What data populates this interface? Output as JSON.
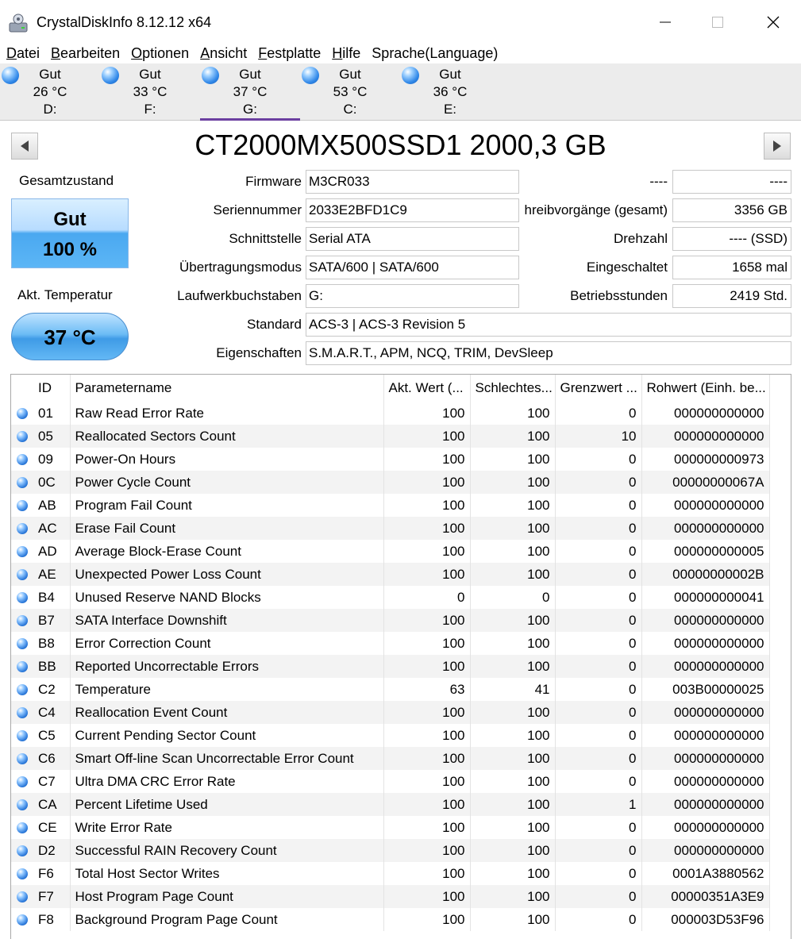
{
  "window": {
    "title": "CrystalDiskInfo 8.12.12 x64"
  },
  "menu": [
    {
      "label": "Datei",
      "hotkey": "D",
      "rest": "atei"
    },
    {
      "label": "Bearbeiten",
      "hotkey": "B",
      "rest": "earbeiten"
    },
    {
      "label": "Optionen",
      "hotkey": "O",
      "rest": "ptionen"
    },
    {
      "label": "Ansicht",
      "hotkey": "A",
      "rest": "nsicht"
    },
    {
      "label": "Festplatte",
      "hotkey": "F",
      "rest": "estplatte"
    },
    {
      "label": "Hilfe",
      "hotkey": "H",
      "rest": "ilfe"
    },
    {
      "label": "Sprache(Language)",
      "hotkey": "",
      "rest": "Sprache(Language)"
    }
  ],
  "drives": [
    {
      "status": "Gut",
      "temp": "26 °C",
      "letter": "D:"
    },
    {
      "status": "Gut",
      "temp": "33 °C",
      "letter": "F:"
    },
    {
      "status": "Gut",
      "temp": "37 °C",
      "letter": "G:"
    },
    {
      "status": "Gut",
      "temp": "53 °C",
      "letter": "C:"
    },
    {
      "status": "Gut",
      "temp": "36 °C",
      "letter": "E:"
    }
  ],
  "selected_drive": "G:",
  "model": "CT2000MX500SSD1 2000,3 GB",
  "health": {
    "label": "Gesamtzustand",
    "status": "Gut",
    "percent": "100 %",
    "color": "#4aa8f0"
  },
  "temperature": {
    "label": "Akt. Temperatur",
    "value": "37 °C"
  },
  "info": {
    "firmware_label": "Firmware",
    "firmware": "M3CR033",
    "serial_label": "Seriennummer",
    "serial": "2033E2BFD1C9",
    "interface_label": "Schnittstelle",
    "interface": "Serial ATA",
    "transfer_label": "Übertragungsmodus",
    "transfer": "SATA/600 | SATA/600",
    "letters_label": "Laufwerkbuchstaben",
    "letters": "G:",
    "standard_label": "Standard",
    "standard": "ACS-3 | ACS-3 Revision 5",
    "features_label": "Eigenschaften",
    "features": "S.M.A.R.T., APM, NCQ, TRIM, DevSleep",
    "r1_label": "----",
    "r1_value": "----",
    "writes_label": "hreibvorgänge (gesamt)",
    "writes_value": "3356 GB",
    "rpm_label": "Drehzahl",
    "rpm_value": "---- (SSD)",
    "power_on_count_label": "Eingeschaltet",
    "power_on_count_value": "1658 mal",
    "hours_label": "Betriebsstunden",
    "hours_value": "2419 Std."
  },
  "table": {
    "headers": [
      "ID",
      "Parametername",
      "Akt. Wert (...",
      "Schlechtes...",
      "Grenzwert ...",
      "Rohwert (Einh. be..."
    ],
    "rows": [
      {
        "id": "01",
        "name": "Raw Read Error Rate",
        "current": "100",
        "worst": "100",
        "threshold": "0",
        "raw": "000000000000"
      },
      {
        "id": "05",
        "name": "Reallocated Sectors Count",
        "current": "100",
        "worst": "100",
        "threshold": "10",
        "raw": "000000000000"
      },
      {
        "id": "09",
        "name": "Power-On Hours",
        "current": "100",
        "worst": "100",
        "threshold": "0",
        "raw": "000000000973"
      },
      {
        "id": "0C",
        "name": "Power Cycle Count",
        "current": "100",
        "worst": "100",
        "threshold": "0",
        "raw": "00000000067A"
      },
      {
        "id": "AB",
        "name": "Program Fail Count",
        "current": "100",
        "worst": "100",
        "threshold": "0",
        "raw": "000000000000"
      },
      {
        "id": "AC",
        "name": "Erase Fail Count",
        "current": "100",
        "worst": "100",
        "threshold": "0",
        "raw": "000000000000"
      },
      {
        "id": "AD",
        "name": "Average Block-Erase Count",
        "current": "100",
        "worst": "100",
        "threshold": "0",
        "raw": "000000000005"
      },
      {
        "id": "AE",
        "name": "Unexpected Power Loss Count",
        "current": "100",
        "worst": "100",
        "threshold": "0",
        "raw": "00000000002B"
      },
      {
        "id": "B4",
        "name": "Unused Reserve NAND Blocks",
        "current": "0",
        "worst": "0",
        "threshold": "0",
        "raw": "000000000041"
      },
      {
        "id": "B7",
        "name": "SATA Interface Downshift",
        "current": "100",
        "worst": "100",
        "threshold": "0",
        "raw": "000000000000"
      },
      {
        "id": "B8",
        "name": "Error Correction Count",
        "current": "100",
        "worst": "100",
        "threshold": "0",
        "raw": "000000000000"
      },
      {
        "id": "BB",
        "name": "Reported Uncorrectable Errors",
        "current": "100",
        "worst": "100",
        "threshold": "0",
        "raw": "000000000000"
      },
      {
        "id": "C2",
        "name": "Temperature",
        "current": "63",
        "worst": "41",
        "threshold": "0",
        "raw": "003B00000025"
      },
      {
        "id": "C4",
        "name": "Reallocation Event Count",
        "current": "100",
        "worst": "100",
        "threshold": "0",
        "raw": "000000000000"
      },
      {
        "id": "C5",
        "name": "Current Pending Sector Count",
        "current": "100",
        "worst": "100",
        "threshold": "0",
        "raw": "000000000000"
      },
      {
        "id": "C6",
        "name": "Smart Off-line Scan Uncorrectable Error Count",
        "current": "100",
        "worst": "100",
        "threshold": "0",
        "raw": "000000000000"
      },
      {
        "id": "C7",
        "name": "Ultra DMA CRC Error Rate",
        "current": "100",
        "worst": "100",
        "threshold": "0",
        "raw": "000000000000"
      },
      {
        "id": "CA",
        "name": "Percent Lifetime Used",
        "current": "100",
        "worst": "100",
        "threshold": "1",
        "raw": "000000000000"
      },
      {
        "id": "CE",
        "name": "Write Error Rate",
        "current": "100",
        "worst": "100",
        "threshold": "0",
        "raw": "000000000000"
      },
      {
        "id": "D2",
        "name": "Successful RAIN Recovery Count",
        "current": "100",
        "worst": "100",
        "threshold": "0",
        "raw": "000000000000"
      },
      {
        "id": "F6",
        "name": "Total Host Sector Writes",
        "current": "100",
        "worst": "100",
        "threshold": "0",
        "raw": "0001A3880562"
      },
      {
        "id": "F7",
        "name": "Host Program Page Count",
        "current": "100",
        "worst": "100",
        "threshold": "0",
        "raw": "00000351A3E9"
      },
      {
        "id": "F8",
        "name": "Background Program Page Count",
        "current": "100",
        "worst": "100",
        "threshold": "0",
        "raw": "000003D53F96"
      }
    ]
  }
}
